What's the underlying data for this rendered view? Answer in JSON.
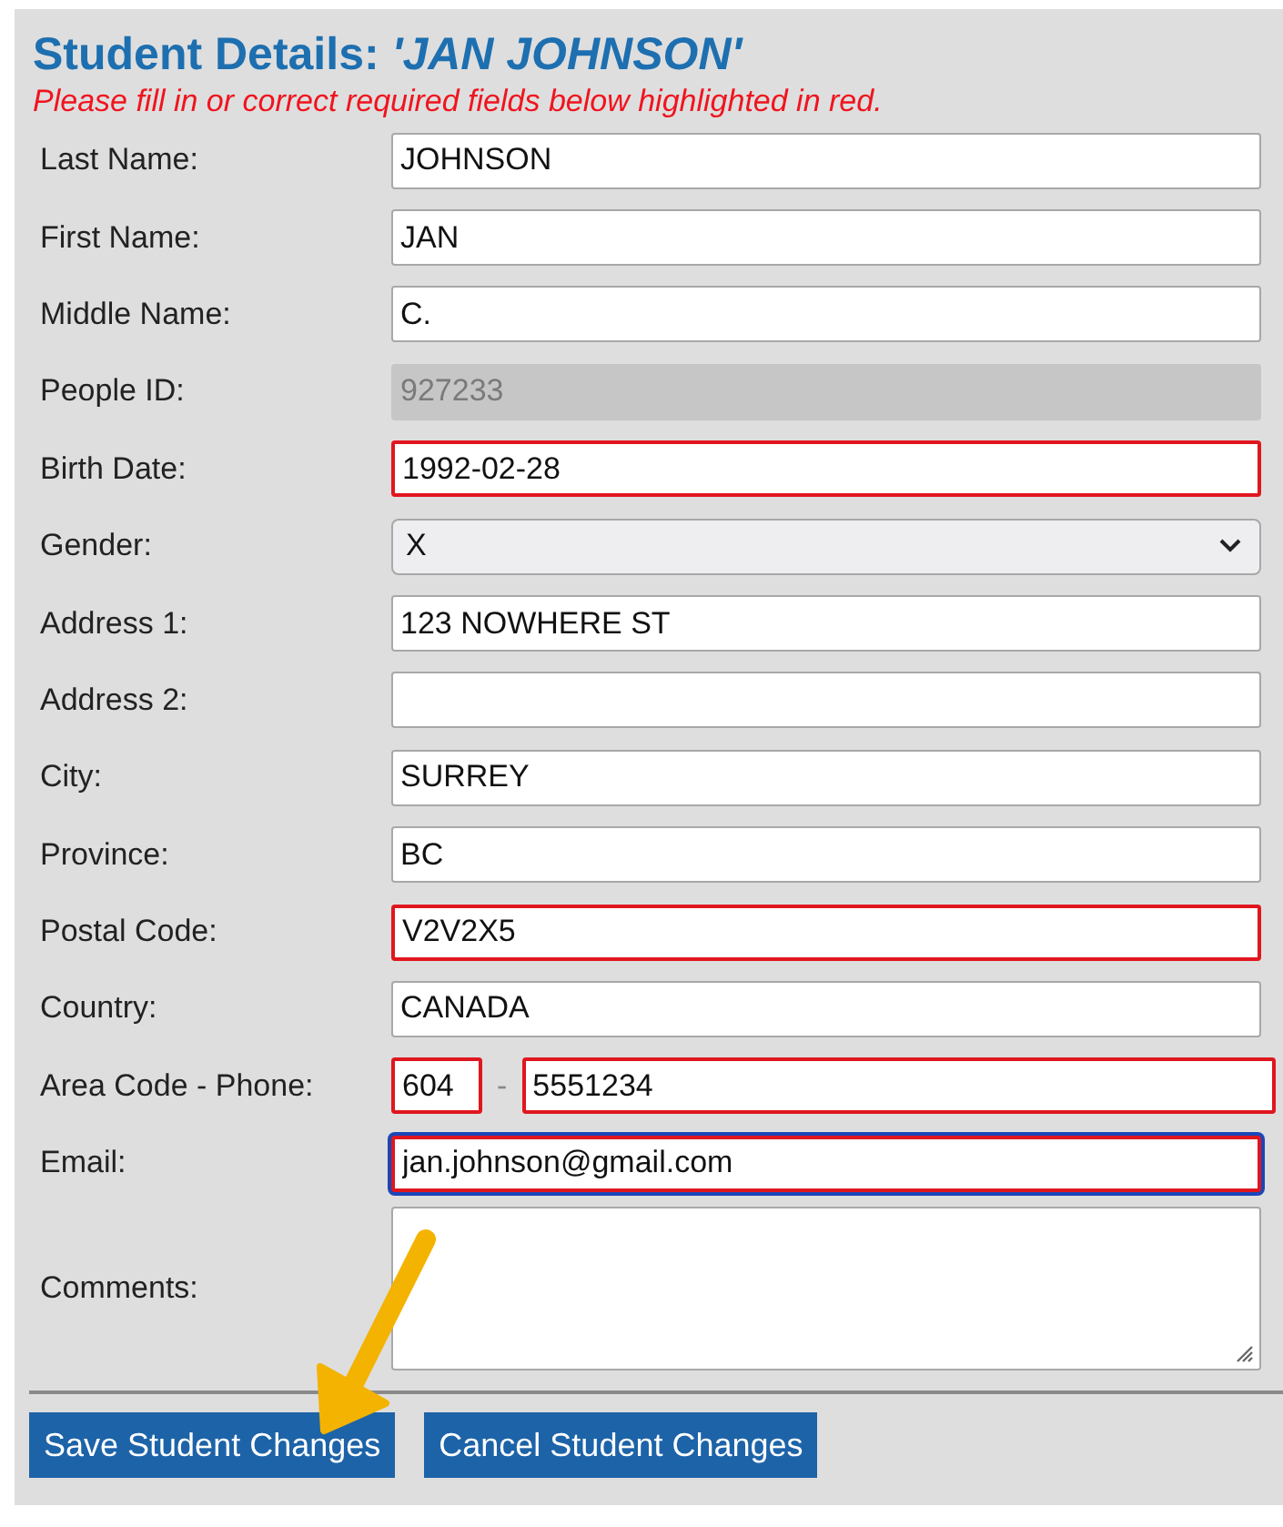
{
  "title": "Student Details: *'JAN JOHNSON'*",
  "message": "Please fill in or correct required fields below highlighted in red.",
  "fields": [
    {
      "kind": "text",
      "label": "Last Name:",
      "value": "JOHNSON",
      "error": false,
      "disabled": false,
      "focused": false
    },
    {
      "kind": "text",
      "label": "First Name:",
      "value": "JAN",
      "error": false,
      "disabled": false,
      "focused": false
    },
    {
      "kind": "text",
      "label": "Middle Name:",
      "value": "C.",
      "error": false,
      "disabled": false,
      "focused": false
    },
    {
      "kind": "text",
      "label": "People ID:",
      "value": "927233",
      "error": false,
      "disabled": true,
      "focused": false
    },
    {
      "kind": "text",
      "label": "Birth Date:",
      "value": "1992-02-28",
      "error": true,
      "disabled": false,
      "focused": false
    },
    {
      "kind": "select",
      "label": "Gender:",
      "value": "X",
      "error": false,
      "disabled": false,
      "focused": false
    },
    {
      "kind": "text",
      "label": "Address 1:",
      "value": "123 NOWHERE ST",
      "error": false,
      "disabled": false,
      "focused": false
    },
    {
      "kind": "text",
      "label": "Address 2:",
      "error": false,
      "disabled": false,
      "focused": false
    },
    {
      "kind": "text",
      "label": "City:",
      "value": "SURREY",
      "error": false,
      "disabled": false,
      "focused": false
    },
    {
      "kind": "text",
      "label": "Province:",
      "value": "BC",
      "error": false,
      "disabled": false,
      "focused": false
    },
    {
      "kind": "text",
      "label": "Postal Code:",
      "value": "V2V2X5",
      "error": true,
      "disabled": false,
      "focused": false
    },
    {
      "kind": "text",
      "label": "Country:",
      "value": "CANADA",
      "error": false,
      "disabled": false,
      "focused": false
    },
    {
      "kind": "phone",
      "label": "Area Code - Phone:",
      "area": "604",
      "separator": "-",
      "value": "5551234",
      "error": true,
      "disabled": false,
      "focused": false
    },
    {
      "kind": "text",
      "label": "Email:",
      "value": "jan.johnson@gmail.com",
      "error": true,
      "disabled": false,
      "focused": true
    },
    {
      "kind": "textarea",
      "label": "Comments:",
      "error": false,
      "disabled": false,
      "focused": false
    }
  ],
  "buttons": [
    "Save Student Changes",
    "Cancel Student Changes"
  ]
}
